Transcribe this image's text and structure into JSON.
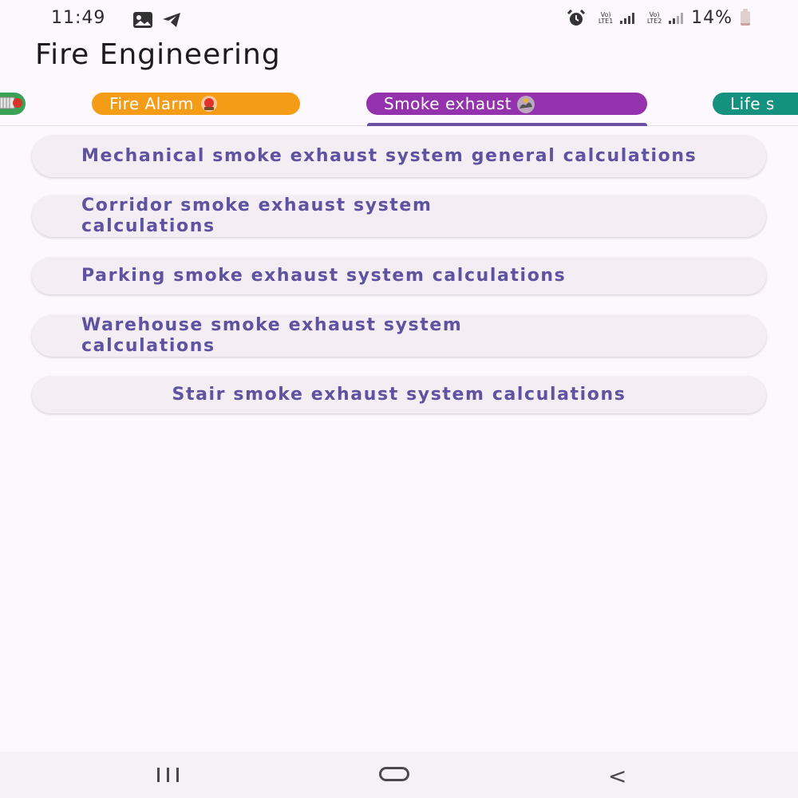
{
  "status_bar": {
    "time": "11:49",
    "sim1_label": "Vo) LTE1",
    "sim2_label": "Vo) LTE2",
    "battery": "14%",
    "icons": [
      "image-icon",
      "telegram-icon",
      "alarm-icon",
      "signal-icon",
      "battery-icon"
    ]
  },
  "app": {
    "title": "Fire Engineering"
  },
  "tabs": [
    {
      "label": "",
      "color": "#3aa156",
      "icon": "fire-sprinkler-icon"
    },
    {
      "label": "Fire Alarm",
      "color": "#f59c16",
      "icon": "alarm-light-icon"
    },
    {
      "label": "Smoke exhaust",
      "color": "#9431ad",
      "icon": "smoke-icon",
      "selected": true
    },
    {
      "label": "Life s",
      "color": "#14917f",
      "icon": ""
    }
  ],
  "menu": {
    "items": [
      {
        "label": "Mechanical smoke exhaust system general calculations"
      },
      {
        "label": "Corridor smoke exhaust system calculations"
      },
      {
        "label": "Parking smoke exhaust system calculations"
      },
      {
        "label": "Warehouse smoke exhaust system calculations"
      },
      {
        "label": "Stair smoke exhaust system calculations"
      }
    ]
  },
  "nav": {
    "recent": "recent-apps-icon",
    "home": "home-icon",
    "back": "<"
  },
  "colors": {
    "accent": "#6a4fa3",
    "item_text": "#5d53a0",
    "item_bg": "#f4eef4",
    "background": "#fdf8fd"
  }
}
